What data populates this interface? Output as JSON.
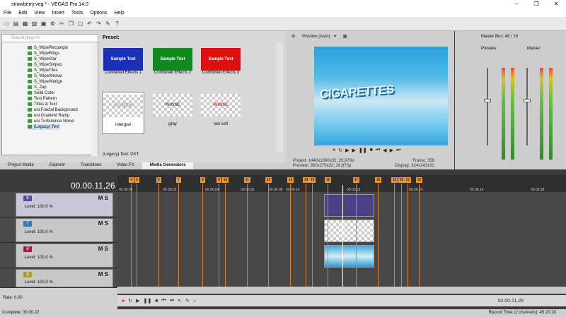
{
  "app": {
    "title": "strawberry.veg * - VEGAS Pro 14.0",
    "window_controls": [
      "–",
      "❐",
      "✕"
    ]
  },
  "menu": [
    "File",
    "Edit",
    "View",
    "Insert",
    "Tools",
    "Options",
    "Help"
  ],
  "plugin_tree": {
    "search_placeholder": "Search plug-ins",
    "items": [
      "S_WipeRectangle",
      "S_WipeRings",
      "S_WipeStar",
      "S_WipeStripes",
      "S_WipeTiles",
      "S_WipeWeave",
      "S_WipeWedge",
      "S_Zap",
      "Solid Color",
      "Test Pattern",
      "Titles & Text",
      "uni.Fractal Background",
      "uni.Gradient Ramp",
      "uni.Turbulence Noise",
      "(Legacy) Text"
    ]
  },
  "presets": {
    "label": "Preset:",
    "items": [
      {
        "label": "Combined Effects 1",
        "thumb_text": "Sample Text",
        "color": "#1b2fb8"
      },
      {
        "label": "Combined Effects 2",
        "thumb_text": "Sample Text",
        "color": "#0f8a1c"
      },
      {
        "label": "Combined Effects 3",
        "thumb_text": "Sample Text",
        "color": "#e01010"
      },
      {
        "label": "intergral",
        "thumb_text": "PLAYING",
        "color": "#cfcfcf"
      },
      {
        "label": "gray",
        "thumb_text": "PHONE",
        "color": "#cfcfcf"
      },
      {
        "label": "red soft",
        "thumb_text": "PHONE",
        "color": "#cfcfcf"
      }
    ],
    "footer": "(Legacy) Text: DXT"
  },
  "tabs": [
    "Project Media",
    "Explorer",
    "Transitions",
    "Video FX",
    "Media Generators"
  ],
  "preview": {
    "mode": "Preview (Auto)",
    "overlay_text": "CIGARETTES",
    "project": "Project:   1440x1080x32; 29,970p",
    "preview": "Preview:   360x270x32; 29,970p",
    "frame": "Frame:        356",
    "display": "Display:     324x243x32"
  },
  "master": {
    "title": "Master Bus: 48 / 16",
    "preview_label": "Preview",
    "master_label": "Master"
  },
  "timeline": {
    "timecode": "00.00.11,26",
    "ruler_ticks": [
      "00.00.00",
      "00.00.02",
      "00.00.04",
      "00.00.06",
      "00.00.08",
      "00.00.10",
      "00.00.12",
      "00.00.14",
      "00.00.16",
      "00.00.18"
    ],
    "markers": [
      "4",
      "5",
      "6",
      "7",
      "8",
      "9",
      "10",
      "11",
      "12",
      "13",
      "14",
      "15",
      "16",
      "17",
      "18",
      "19",
      "20",
      "21",
      "22"
    ],
    "tracks": [
      {
        "num": "6",
        "level": "Level: 100,0 %",
        "color": "#5b4fa0"
      },
      {
        "num": "7",
        "level": "Level: 100,0 %",
        "color": "#2a7fb8"
      },
      {
        "num": "8",
        "level": "Level: 100,0 %",
        "color": "#a02040"
      },
      {
        "num": "9",
        "level": "Level: 100,0 %",
        "color": "#b0a020"
      }
    ],
    "ms": "M  S"
  },
  "bottom": {
    "rate": "Rate: 0,00",
    "cursor_time": "00.00.11,26",
    "status_left": "Complete: 00.00.22",
    "status_right": "Record Time (2 channels): 45.20.20"
  }
}
